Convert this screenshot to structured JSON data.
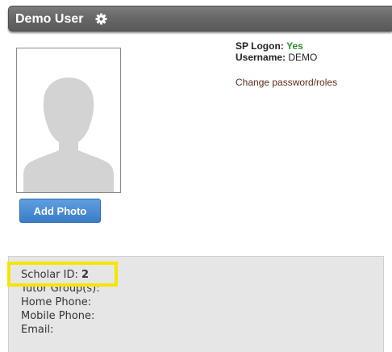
{
  "header": {
    "title": "Demo User",
    "settings_icon": "gear-icon"
  },
  "photo": {
    "placeholder_icon": "silhouette-icon",
    "add_button_label": "Add Photo"
  },
  "account": {
    "sp_logon_label": "SP Logon:",
    "sp_logon_value": "Yes",
    "username_label": "Username:",
    "username_value": "DEMO",
    "change_link": "Change password/roles"
  },
  "details": {
    "scholar_id_label": "Scholar ID:",
    "scholar_id_value": "2",
    "tutor_group_label": "Tutor Group(s):",
    "home_phone_label": "Home Phone:",
    "mobile_phone_label": "Mobile Phone:",
    "email_label": "Email:"
  },
  "colors": {
    "highlight": "#f5e600",
    "button": "#3a7cc8",
    "yes": "#2e8b2e"
  }
}
